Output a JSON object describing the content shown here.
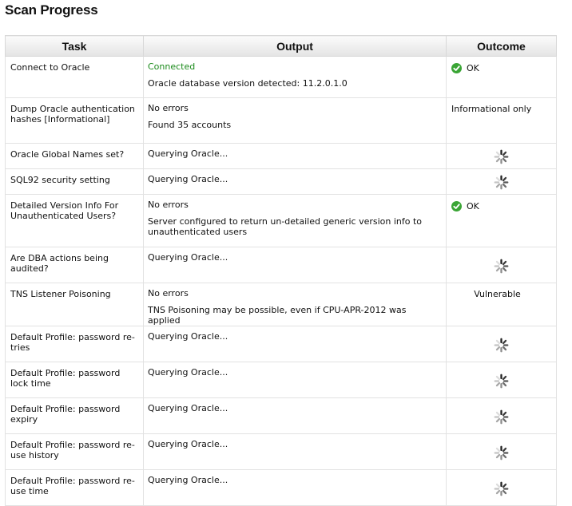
{
  "page": {
    "title": "Scan Progress"
  },
  "table": {
    "headers": {
      "task": "Task",
      "output": "Output",
      "outcome": "Outcome"
    },
    "colors": {
      "connected": "#1a8a1a",
      "ok": "#3aa535"
    },
    "rows": [
      {
        "task": "Connect to Oracle",
        "output": [
          {
            "text": "Connected",
            "color": "#1a8a1a"
          },
          {
            "text": "Oracle database version detected: 11.2.0.1.0"
          }
        ],
        "outcome": {
          "type": "ok",
          "label": "OK",
          "icon": "check-icon"
        }
      },
      {
        "task": "Dump Oracle authentication hashes [Informational]",
        "output": [
          {
            "text": "No errors"
          },
          {
            "text": "Found 35 accounts"
          }
        ],
        "outcome": {
          "type": "text",
          "label": "Informational only"
        }
      },
      {
        "task": "Oracle Global Names set?",
        "output": [
          {
            "text": "Querying Oracle..."
          }
        ],
        "outcome": {
          "type": "spinner",
          "icon": "spinner-icon"
        }
      },
      {
        "task": "SQL92 security setting",
        "output": [
          {
            "text": "Querying Oracle..."
          }
        ],
        "outcome": {
          "type": "spinner",
          "icon": "spinner-icon"
        }
      },
      {
        "task": "Detailed Version Info For Unauthenticated Users?",
        "output": [
          {
            "text": "No errors"
          },
          {
            "text": "Server configured to return un-detailed generic version info to unauthenticated users"
          }
        ],
        "outcome": {
          "type": "ok",
          "label": "OK",
          "icon": "check-icon"
        }
      },
      {
        "task": "Are DBA actions being audited?",
        "output": [
          {
            "text": "Querying Oracle..."
          }
        ],
        "outcome": {
          "type": "spinner",
          "icon": "spinner-icon"
        }
      },
      {
        "task": "TNS Listener Poisoning",
        "output": [
          {
            "text": "No errors"
          },
          {
            "text": "TNS Poisoning may be possible, even if CPU-APR-2012 was applied"
          }
        ],
        "outcome": {
          "type": "center",
          "label": "Vulnerable"
        }
      },
      {
        "task": "Default Profile: password re-tries",
        "output": [
          {
            "text": "Querying Oracle..."
          }
        ],
        "outcome": {
          "type": "spinner",
          "icon": "spinner-icon"
        }
      },
      {
        "task": "Default Profile: password lock time",
        "output": [
          {
            "text": "Querying Oracle..."
          }
        ],
        "outcome": {
          "type": "spinner",
          "icon": "spinner-icon"
        }
      },
      {
        "task": "Default Profile: password expiry",
        "output": [
          {
            "text": "Querying Oracle..."
          }
        ],
        "outcome": {
          "type": "spinner",
          "icon": "spinner-icon"
        }
      },
      {
        "task": "Default Profile: password re-use history",
        "output": [
          {
            "text": "Querying Oracle..."
          }
        ],
        "outcome": {
          "type": "spinner",
          "icon": "spinner-icon"
        }
      },
      {
        "task": "Default Profile: password re-use time",
        "output": [
          {
            "text": "Querying Oracle..."
          }
        ],
        "outcome": {
          "type": "spinner",
          "icon": "spinner-icon"
        }
      }
    ]
  }
}
